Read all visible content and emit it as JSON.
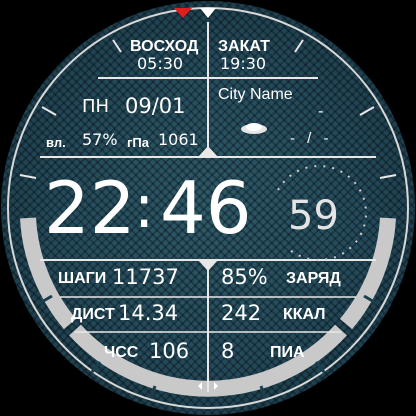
{
  "sunrise": {
    "label": "ВОСХОД",
    "time": "05:30"
  },
  "sunset": {
    "label": "ЗАКАТ",
    "time": "19:30"
  },
  "city": "City Name",
  "date": {
    "weekday": "ПН",
    "value": "09/01"
  },
  "weather": {
    "temp": "-",
    "range": "- / -"
  },
  "environment": {
    "humidity_label": "вл.",
    "humidity": "57%",
    "pressure_label": "гПа",
    "pressure": "1061"
  },
  "time": {
    "hours": "22",
    "separator": ":",
    "minutes": "46",
    "seconds": "59"
  },
  "stats": {
    "steps": {
      "label": "ШАГИ",
      "value": "11737"
    },
    "distance": {
      "label": "ДИСТ",
      "value": "14.34"
    },
    "heart_rate": {
      "label": "ЧСС",
      "value": "106"
    },
    "battery": {
      "label": "ЗАРЯД",
      "value": "85%"
    },
    "calories": {
      "label": "ККАЛ",
      "value": "242"
    },
    "pai": {
      "label": "ПИА",
      "value": "8"
    }
  },
  "colors": {
    "accent": "#e01e1e",
    "text": "#ffffff",
    "bezel": "#c9c9c9",
    "face": "#23495a"
  }
}
